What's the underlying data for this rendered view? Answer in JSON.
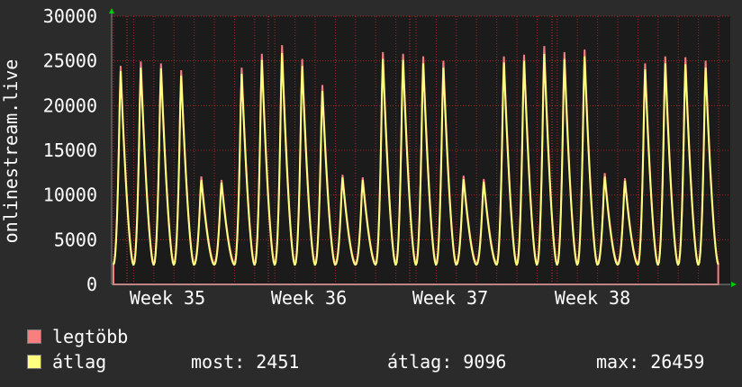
{
  "chart_data": {
    "type": "area",
    "ylabel": "onlinestream.live",
    "ylim": [
      0,
      30000
    ],
    "yticks": [
      0,
      5000,
      10000,
      15000,
      20000,
      25000,
      30000
    ],
    "xticks": [
      "Week 35",
      "Week 36",
      "Week 37",
      "Week 38"
    ],
    "grid": true,
    "colors": {
      "max_area": "#f87f7f",
      "avg_line": "#ffff80",
      "plot_bg": "#1b1b1b",
      "grid": "#aa2020",
      "axis": "#888888",
      "background": "#2b2b2b"
    },
    "x_day": [
      0,
      1,
      2,
      3,
      4,
      5,
      6,
      7,
      8,
      9,
      10,
      11,
      12,
      13,
      14,
      15,
      16,
      17,
      18,
      19,
      20,
      21,
      22,
      23,
      24,
      25,
      26,
      27,
      28,
      29,
      30,
      31,
      32,
      33
    ],
    "daily_max": [
      25200,
      25700,
      25500,
      24700,
      12400,
      12000,
      25000,
      26600,
      27600,
      26000,
      23000,
      12600,
      12300,
      26800,
      26600,
      26300,
      25800,
      12500,
      12100,
      26300,
      26500,
      27500,
      26800,
      27100,
      12800,
      12200,
      25500,
      26300,
      26200,
      25800
    ],
    "daily_avg": [
      24600,
      25000,
      24900,
      24100,
      12000,
      11700,
      24300,
      25900,
      26700,
      25200,
      22300,
      12300,
      12000,
      26000,
      25900,
      25500,
      25000,
      12100,
      11800,
      25600,
      25800,
      26600,
      26000,
      26300,
      12400,
      11900,
      24800,
      25500,
      25400,
      25000
    ],
    "gap_after_day": 3
  },
  "legend": {
    "items": [
      {
        "label": "legtöbb",
        "color": "#f87f7f"
      },
      {
        "label": "átlag",
        "color": "#ffff80"
      }
    ],
    "stats": {
      "now": "most: 2451",
      "avg": "átlag: 9096",
      "max": "max: 26459"
    }
  }
}
